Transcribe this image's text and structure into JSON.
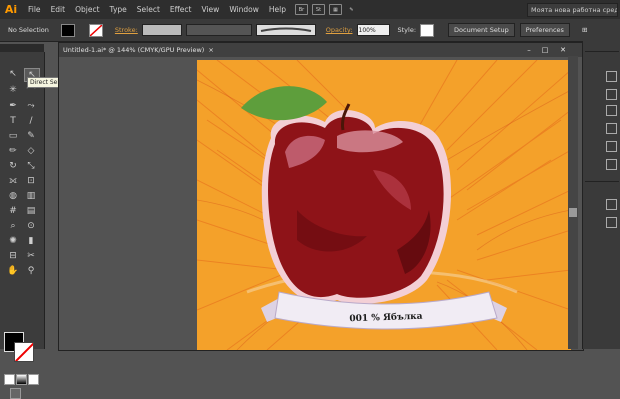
{
  "app": {
    "logo": "Ai",
    "workspace": "Моята нова работна среда"
  },
  "menu": [
    "File",
    "Edit",
    "Object",
    "Type",
    "Select",
    "Effect",
    "View",
    "Window",
    "Help"
  ],
  "menu_icons": [
    "bridge-icon",
    "stock-icon",
    "arrange-documents-icon",
    "brush-icon"
  ],
  "control_bar": {
    "selection": "No Selection",
    "stroke_label": "Stroke:",
    "opacity_label": "Opacity:",
    "opacity_value": "100%",
    "style_label": "Style:",
    "document_setup": "Document Setup",
    "preferences": "Preferences"
  },
  "document": {
    "title": "Untitled-1.ai* @ 144% (CMYK/GPU Preview)",
    "close": "×",
    "minimize": "–",
    "maximize": "□"
  },
  "tooltip": "Direct Selection Tool (A)",
  "artwork": {
    "ribbon_text": "001 % Ябълка"
  },
  "colors": {
    "background": "#f4a12a",
    "apple": "#8e1318",
    "leaf": "#5e9e3c",
    "ribbon": "#f1ecf4",
    "accent": "#ff9a00"
  }
}
